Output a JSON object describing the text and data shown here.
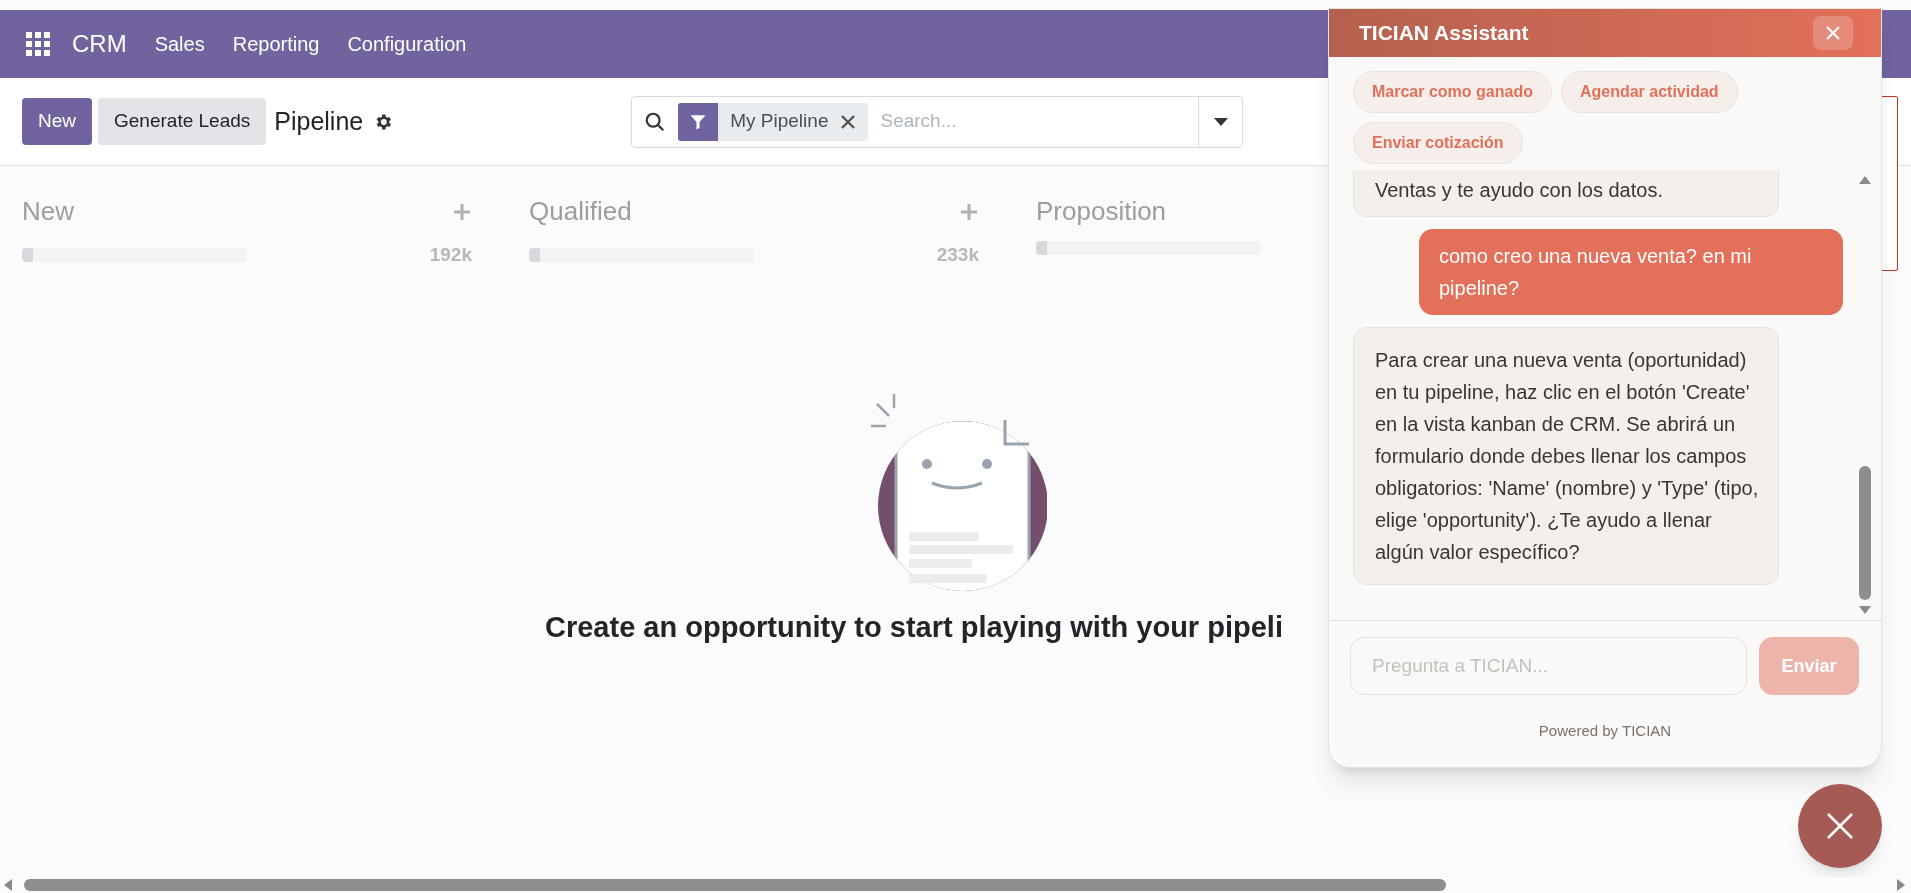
{
  "navbar": {
    "app": "CRM",
    "menu": [
      "Sales",
      "Reporting",
      "Configuration"
    ]
  },
  "control_panel": {
    "buttons": [
      {
        "label": "New",
        "kind": "primary"
      },
      {
        "label": "Generate Leads",
        "kind": "secondary"
      }
    ],
    "breadcrumb": "Pipeline",
    "search": {
      "facet": "My Pipeline",
      "placeholder": "Search..."
    }
  },
  "kanban": {
    "columns": [
      {
        "title": "New",
        "total": "192k",
        "level": 0.05
      },
      {
        "title": "Qualified",
        "total": "233k",
        "level": 0.05
      },
      {
        "title": "Proposition",
        "level": 0.05
      }
    ]
  },
  "empty_state": {
    "heading": "Create an opportunity to start playing with your pipeli"
  },
  "assistant": {
    "title": "TICIAN Assistant",
    "quick_actions": [
      "Marcar como ganado",
      "Agendar actividad",
      "Enviar cotización"
    ],
    "messages": [
      {
        "kind": "bot",
        "text": "Ventas y te ayudo con los datos."
      },
      {
        "kind": "user",
        "text": "como creo una nueva venta? en mi pipeline?"
      },
      {
        "kind": "bot",
        "text": "Para crear una nueva venta (oportunidad) en tu pipeline, haz clic en el botón 'Create' en la vista kanban de CRM. Se abrirá un formulario donde debes llenar los campos obligatorios: 'Name' (nombre) y 'Type' (tipo, elige 'opportunity'). ¿Te ayudo a llenar algún valor específico?"
      }
    ],
    "input": {
      "placeholder": "Pregunta a TICIAN..."
    },
    "send": {
      "label": "Enviar",
      "disabled": true
    },
    "footer": "Powered by TICIAN"
  }
}
